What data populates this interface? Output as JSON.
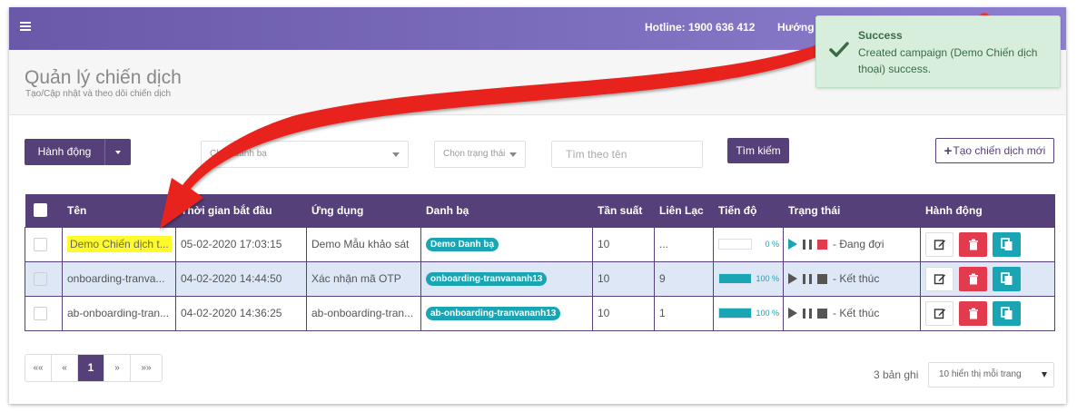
{
  "topbar": {
    "hotline": "Hotline: 1900 636 412",
    "guide": "Hướng"
  },
  "page": {
    "title": "Quản lý chiến dịch",
    "subtitle": "Tạo/Cập nhật và theo dõi chiến dịch"
  },
  "toolbar": {
    "action_label": "Hành động",
    "contact_select": "Chọn danh bạ",
    "status_select": "Chọn trạng thái",
    "search_placeholder": "Tìm theo tên",
    "search_label": "Tìm kiếm",
    "create_label": "Tạo chiến dịch mới"
  },
  "table": {
    "headers": {
      "name": "Tên",
      "start": "Thời gian bắt đầu",
      "app": "Ứng dụng",
      "contacts": "Danh bạ",
      "frequency": "Tần suất",
      "contacted": "Liên Lạc",
      "progress": "Tiến độ",
      "status": "Trạng thái",
      "actions": "Hành động"
    },
    "rows": [
      {
        "name": "Demo Chiến dịch t...",
        "start": "05-02-2020 17:03:15",
        "app": "Demo Mẫu khảo sát",
        "contacts": "Demo Danh bạ",
        "frequency": "10",
        "contacted": "...",
        "progress": 0,
        "progress_label": "0 %",
        "status": "- Đang đợi"
      },
      {
        "name": "onboarding-tranva...",
        "start": "04-02-2020 14:44:50",
        "app": "Xác nhận mã OTP",
        "contacts": "onboarding-tranvananh13",
        "frequency": "10",
        "contacted": "9",
        "progress": 100,
        "progress_label": "100 %",
        "status": "- Kết thúc"
      },
      {
        "name": "ab-onboarding-tran...",
        "start": "04-02-2020 14:36:25",
        "app": "ab-onboarding-tran...",
        "contacts": "ab-onboarding-tranvananh13",
        "frequency": "10",
        "contacted": "1",
        "progress": 100,
        "progress_label": "100 %",
        "status": "- Kết thúc"
      }
    ]
  },
  "pagination": {
    "first": "««",
    "prev": "«",
    "current": "1",
    "next": "»",
    "last": "»»",
    "records": "3 bản ghi",
    "per_page": "10 hiển thị mỗi trang"
  },
  "toast": {
    "title": "Success",
    "message": "Created campaign (Demo Chiến dịch thoại) success."
  },
  "colors": {
    "primary": "#56407a",
    "accent": "#1aa5b5",
    "danger": "#e23b4e",
    "highlight": "#fffb2b",
    "annotation_arrow": "#e8231b"
  }
}
